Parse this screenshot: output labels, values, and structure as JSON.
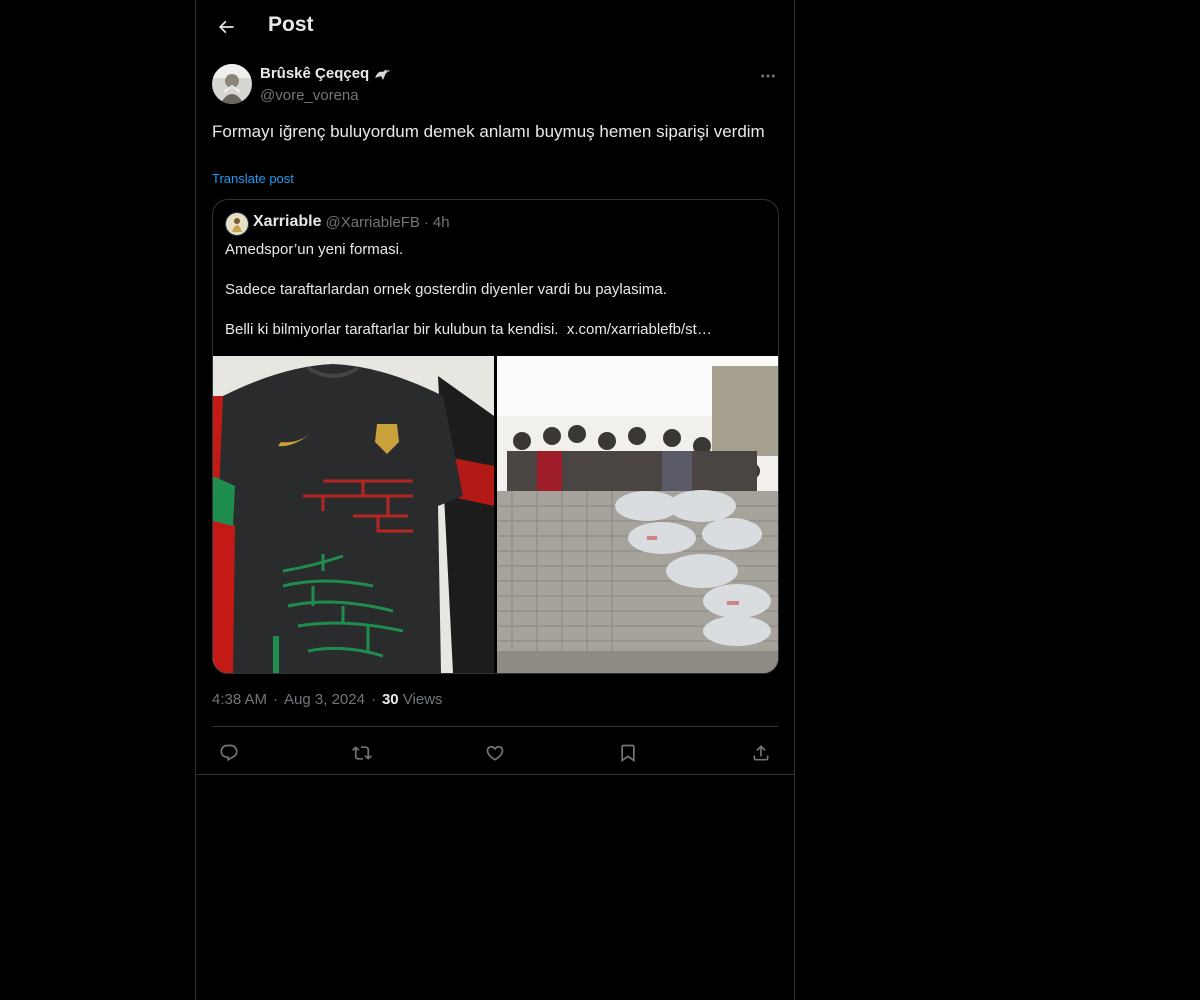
{
  "header": {
    "title": "Post",
    "back_icon": "arrow-left-icon"
  },
  "author": {
    "name": "Brûskê Çeqçeq",
    "name_emoji": "eagle-icon",
    "handle": "@vore_vorena"
  },
  "post": {
    "text": "Formayı iğrenç buluyordum demek anlamı buymuş hemen siparişi verdim",
    "translate_label": "Translate post"
  },
  "quote": {
    "name": "Xarriable",
    "handle": "@XarriableFB",
    "separator": "·",
    "time": "4h",
    "lines": [
      "Amedspor’un yeni formasi.",
      "Sadece taraftarlardan ornek gosterdin diyenler vardi bu paylasima.",
      "Belli ki bilmiyorlar taraftarlar bir kulubun ta kendisi."
    ],
    "link": "x.com/xarriablefb/st…",
    "media": [
      "jersey-photo",
      "crowd-behind-wall-photo"
    ]
  },
  "meta": {
    "time": "4:38 AM",
    "separator": "·",
    "date": "Aug 3, 2024",
    "views_count": "30",
    "views_label": "Views"
  },
  "actions": [
    "reply-icon",
    "repost-icon",
    "like-icon",
    "bookmark-icon",
    "share-icon"
  ],
  "colors": {
    "background": "#000000",
    "text": "#e7e9ea",
    "muted": "#71767b",
    "accent": "#1d9bf0",
    "border": "#2f3336"
  }
}
